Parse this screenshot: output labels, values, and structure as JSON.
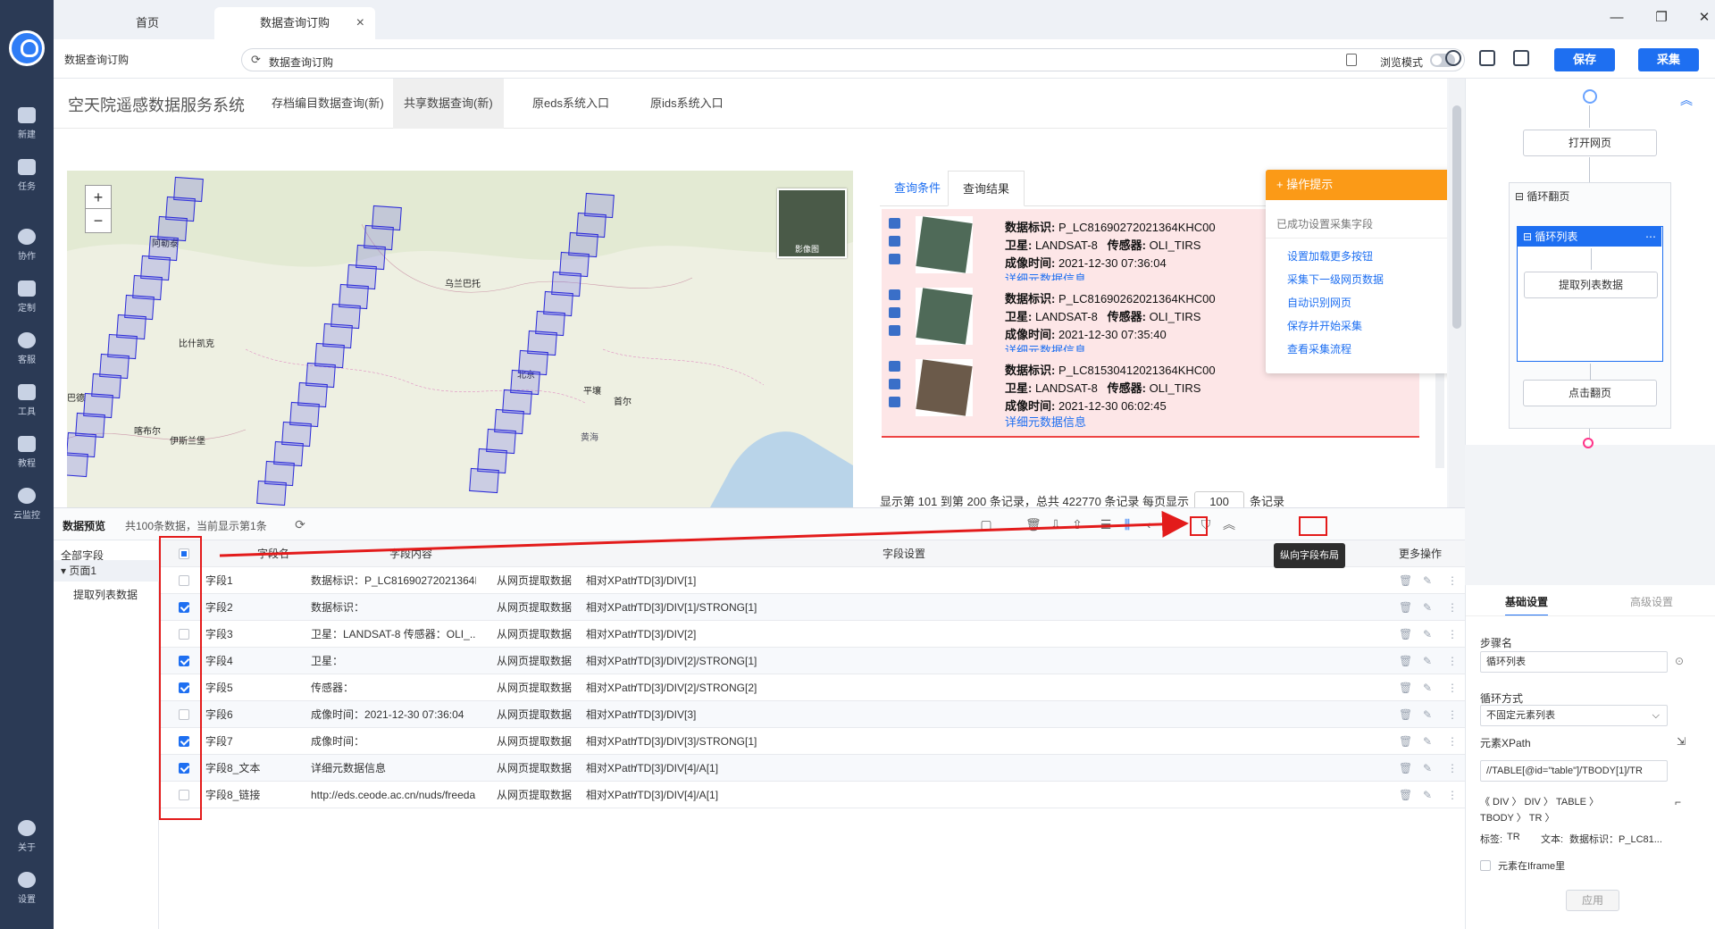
{
  "tabs": [
    {
      "label": "首页"
    },
    {
      "label": "数据查询订购"
    }
  ],
  "addressbar": {
    "crumb": "数据查询订购",
    "url": "数据查询订购",
    "browse_mode": "浏览模式"
  },
  "toolbar": {
    "save": "保存",
    "collect": "采集"
  },
  "rail": [
    {
      "label": "新建"
    },
    {
      "label": "任务"
    },
    {
      "label": "协作"
    },
    {
      "label": "定制"
    },
    {
      "label": "客服"
    },
    {
      "label": "工具"
    },
    {
      "label": "教程"
    },
    {
      "label": "云监控"
    },
    {
      "label": "关于"
    },
    {
      "label": "设置"
    }
  ],
  "site": {
    "brand": "空天院遥感数据服务系统",
    "nav": [
      "存档编目数据查询(新)",
      "共享数据查询(新)",
      "原eds系统入口",
      "原ids系统入口"
    ]
  },
  "map": {
    "minimap_label": "影像图",
    "cities": [
      "阿勒泰",
      "乌兰巴托",
      "比什凯克",
      "巴德",
      "北京",
      "平壤",
      "首尔",
      "伊斯兰堡",
      "喀布尔",
      "黄海"
    ]
  },
  "result_tabs": [
    "查询条件",
    "查询结果"
  ],
  "results": [
    {
      "id": "P_LC81690272021364KHC00",
      "sat": "LANDSAT-8",
      "sensor": "OLI_TIRS",
      "time": "2021-12-30 07:36:04",
      "link": "详细元数据信息"
    },
    {
      "id": "P_LC81690262021364KHC00",
      "sat": "LANDSAT-8",
      "sensor": "OLI_TIRS",
      "time": "2021-12-30 07:35:40",
      "link": "详细元数据信息"
    },
    {
      "id": "P_LC81530412021364KHC00",
      "sat": "LANDSAT-8",
      "sensor": "OLI_TIRS",
      "time": "2021-12-30 06:02:45",
      "link": "详细元数据信息"
    }
  ],
  "labels": {
    "id": "数据标识:",
    "sat": "卫星:",
    "sensor": "传感器:",
    "time": "成像时间:"
  },
  "pager": {
    "text1": "显示第 101 到第 200 条记录，总共 422770 条记录 每页显示",
    "size": "100",
    "text2": "条记录"
  },
  "tips": {
    "title": "操作提示",
    "message": "已成功设置采集字段",
    "actions": [
      "设置加载更多按钮",
      "采集下一级网页数据",
      "自动识别网页",
      "保存并开始采集",
      "查看采集流程"
    ]
  },
  "flow": {
    "nodes": [
      "打开网页",
      "循环翻页",
      "循环列表",
      "提取列表数据",
      "点击翻页"
    ]
  },
  "preview": {
    "title": "数据预览",
    "summary": "共100条数据，当前显示第1条",
    "tree": [
      "全部字段",
      "页面1",
      "提取列表数据"
    ],
    "headers": [
      "字段名",
      "字段内容",
      "字段设置",
      "更多操作"
    ],
    "tooltip": "纵向字段布局",
    "rows": [
      {
        "name": "字段1",
        "content": "数据标识：P_LC81690272021364K...",
        "source": "从网页提取数据",
        "mode": "相对XPath",
        "xpath": "/TD[3]/DIV[1]",
        "checked": false
      },
      {
        "name": "字段2",
        "content": "数据标识：",
        "source": "从网页提取数据",
        "mode": "相对XPath",
        "xpath": "/TD[3]/DIV[1]/STRONG[1]",
        "checked": true
      },
      {
        "name": "字段3",
        "content": "卫星：LANDSAT-8  传感器：OLI_...",
        "source": "从网页提取数据",
        "mode": "相对XPath",
        "xpath": "/TD[3]/DIV[2]",
        "checked": false
      },
      {
        "name": "字段4",
        "content": "卫星：",
        "source": "从网页提取数据",
        "mode": "相对XPath",
        "xpath": "/TD[3]/DIV[2]/STRONG[1]",
        "checked": true
      },
      {
        "name": "字段5",
        "content": "传感器：",
        "source": "从网页提取数据",
        "mode": "相对XPath",
        "xpath": "/TD[3]/DIV[2]/STRONG[2]",
        "checked": true
      },
      {
        "name": "字段6",
        "content": "成像时间：2021-12-30 07:36:04",
        "source": "从网页提取数据",
        "mode": "相对XPath",
        "xpath": "/TD[3]/DIV[3]",
        "checked": false
      },
      {
        "name": "字段7",
        "content": "成像时间：",
        "source": "从网页提取数据",
        "mode": "相对XPath",
        "xpath": "/TD[3]/DIV[3]/STRONG[1]",
        "checked": true
      },
      {
        "name": "字段8_文本",
        "content": "详细元数据信息",
        "source": "从网页提取数据",
        "mode": "相对XPath",
        "xpath": "/TD[3]/DIV[4]/A[1]",
        "checked": true
      },
      {
        "name": "字段8_链接",
        "content": "http://eds.ceode.ac.cn/nuds/freeda...",
        "source": "从网页提取数据",
        "mode": "相对XPath",
        "xpath": "/TD[3]/DIV[4]/A[1]",
        "checked": false
      }
    ]
  },
  "settings": {
    "tabs": [
      "基础设置",
      "高级设置"
    ],
    "step_label": "步骤名",
    "step_value": "循环列表",
    "loop_label": "循环方式",
    "loop_value": "不固定元素列表",
    "xpath_label": "元素XPath",
    "xpath_value": "//TABLE[@id=\"table\"]/TBODY[1]/TR",
    "path_chain_1": "《 DIV 〉 DIV 〉 TABLE 〉",
    "path_chain_2": "TBODY 〉 TR 〉",
    "tag_label": "标签:",
    "tag_value": "TR",
    "text_label": "文本:",
    "text_value": "数据标识：P_LC81...",
    "iframe_label": "元素在Iframe里",
    "apply": "应用"
  }
}
